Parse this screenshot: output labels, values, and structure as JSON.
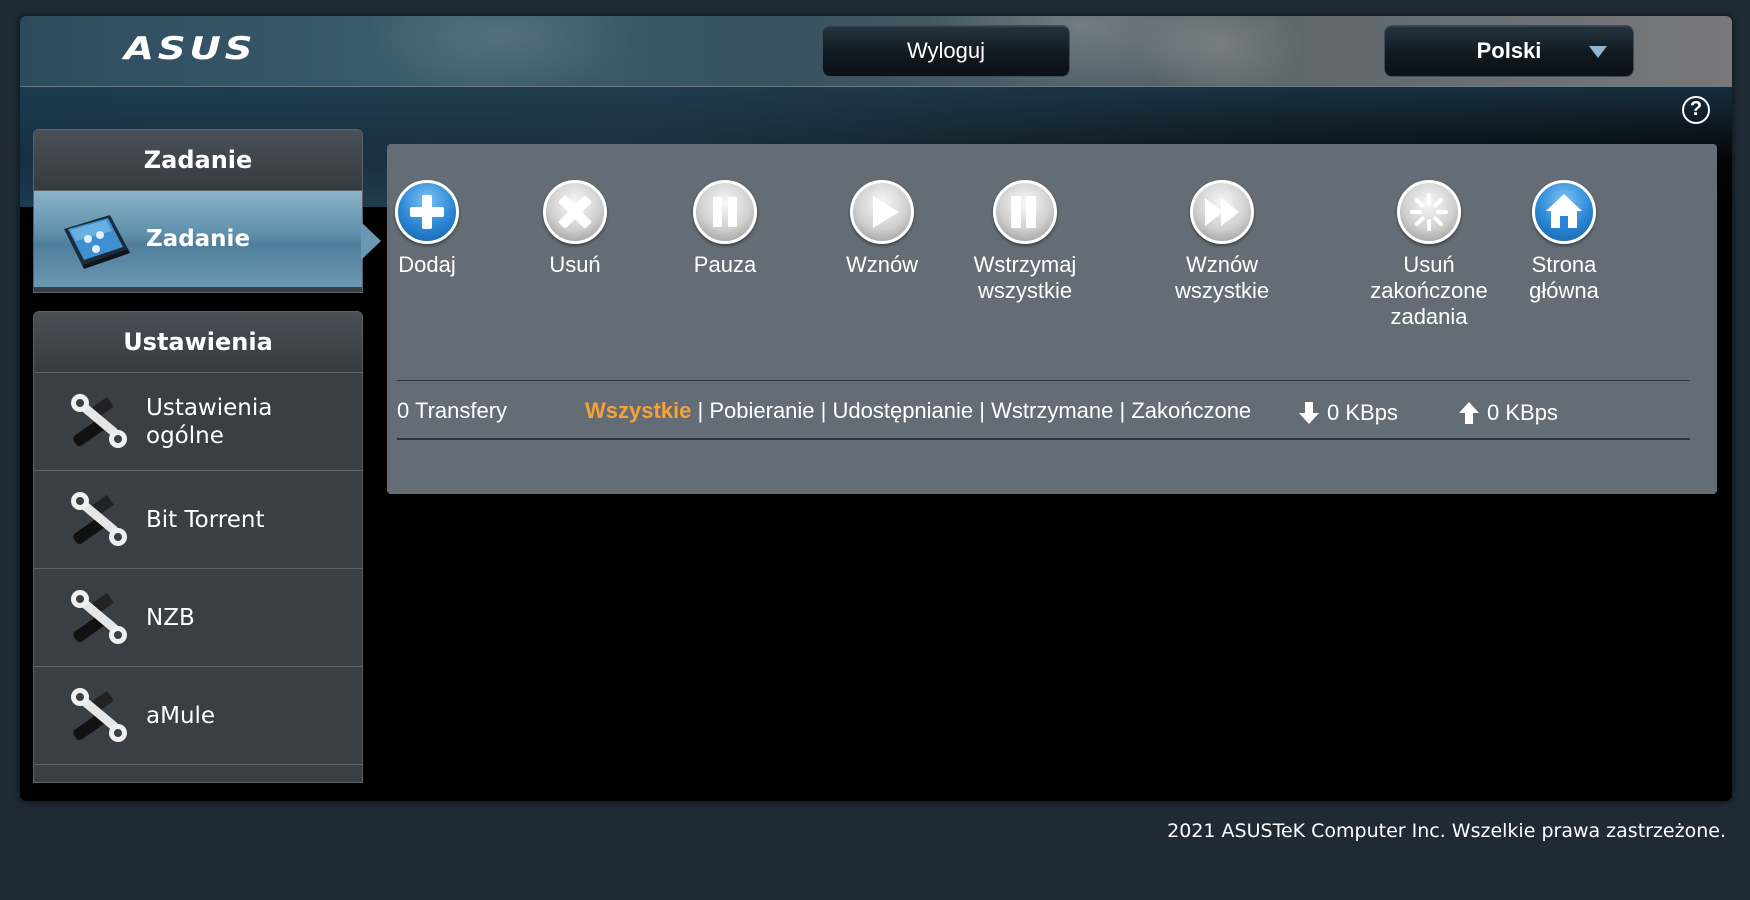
{
  "header": {
    "logo_text": "ASUS",
    "logout_label": "Wyloguj",
    "language_label": "Polski"
  },
  "sidebar": {
    "task_section": {
      "title": "Zadanie",
      "items": [
        {
          "label": "Zadanie",
          "icon": "task-monitor-icon",
          "active": true
        }
      ]
    },
    "settings_section": {
      "title": "Ustawienia",
      "items": [
        {
          "label": "Ustawienia\nogólne",
          "icon": "tools-icon"
        },
        {
          "label": "Bit Torrent",
          "icon": "tools-icon"
        },
        {
          "label": "NZB",
          "icon": "tools-icon"
        },
        {
          "label": "aMule",
          "icon": "tools-icon"
        }
      ]
    }
  },
  "toolbar": {
    "add_label": "Dodaj",
    "delete_label": "Usuń",
    "pause_label": "Pauza",
    "resume_label": "Wznów",
    "pause_all_label": "Wstrzymaj\nwszystkie",
    "resume_all_label": "Wznów\nwszystkie",
    "clear_completed_label": "Usuń\nzakończone\nzadania",
    "home_label": "Strona\ngłówna"
  },
  "status": {
    "transfers": "0 Transfery",
    "filters": [
      "Wszystkie",
      "Pobieranie",
      "Udostępnianie",
      "Wstrzymane",
      "Zakończone"
    ],
    "active_filter": "Wszystkie",
    "separator": " | ",
    "download_speed": "0 KBps",
    "upload_speed": "0 KBps"
  },
  "footer": {
    "copyright": "2021 ASUSTeK Computer Inc. Wszelkie prawa zastrzeżone."
  },
  "colors": {
    "accent_orange": "#f7a234",
    "panel_gray": "#646d75",
    "active_blue": "#5f8fab"
  }
}
